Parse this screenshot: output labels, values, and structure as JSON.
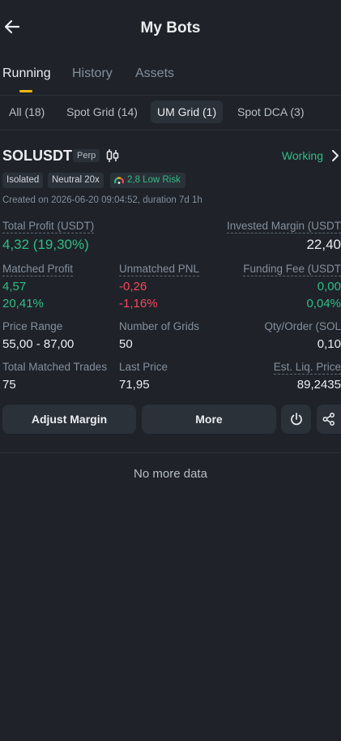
{
  "header": {
    "title": "My Bots",
    "back_icon": "arrow-left-icon"
  },
  "tabs": [
    {
      "label": "Running",
      "active": true
    },
    {
      "label": "History",
      "active": false
    },
    {
      "label": "Assets",
      "active": false
    }
  ],
  "filters": [
    {
      "label": "All (18)",
      "active": false
    },
    {
      "label": "Spot Grid (14)",
      "active": false
    },
    {
      "label": "UM Grid (1)",
      "active": true
    },
    {
      "label": "Spot DCA (3)",
      "active": false
    }
  ],
  "bot": {
    "symbol": "SOLUSDT",
    "contract_tag": "Perp",
    "status": "Working",
    "badges": {
      "margin_mode": "Isolated",
      "direction": "Neutral 20x",
      "risk": "2,8 Low Risk"
    },
    "created": "Created on 2026-06-20 09:04:52, duration 7d 1h",
    "total_profit": {
      "label": "Total Profit (USDT)",
      "value": "4,32 (19,30%)"
    },
    "invested_margin": {
      "label": "Invested Margin (USDT",
      "value": "22,40"
    },
    "matched_profit": {
      "label": "Matched Profit",
      "value": "4,57",
      "pct": "20,41%"
    },
    "unmatched_pnl": {
      "label": "Unmatched PNL",
      "value": "-0,26",
      "pct": "-1,16%"
    },
    "funding_fee": {
      "label": "Funding Fee (USDT",
      "value": "0,00",
      "pct": "0,04%"
    },
    "price_range": {
      "label": "Price Range",
      "value": "55,00 - 87,00"
    },
    "grids": {
      "label": "Number of Grids",
      "value": "50"
    },
    "qty_order": {
      "label": "Qty/Order (SOL",
      "value": "0,10"
    },
    "matched_trades": {
      "label": "Total Matched Trades",
      "value": "75"
    },
    "last_price": {
      "label": "Last Price",
      "value": "71,95"
    },
    "liq_price": {
      "label": "Est. Liq. Price",
      "value": "89,2435"
    }
  },
  "actions": {
    "adjust_margin": "Adjust Margin",
    "more": "More",
    "stop_icon": "power-icon",
    "share_icon": "share-icon"
  },
  "footer": {
    "no_more": "No more data"
  },
  "colors": {
    "background": "#1f2329",
    "accent": "#f0b90b",
    "positive": "#2ebd85",
    "negative": "#f6465d"
  }
}
